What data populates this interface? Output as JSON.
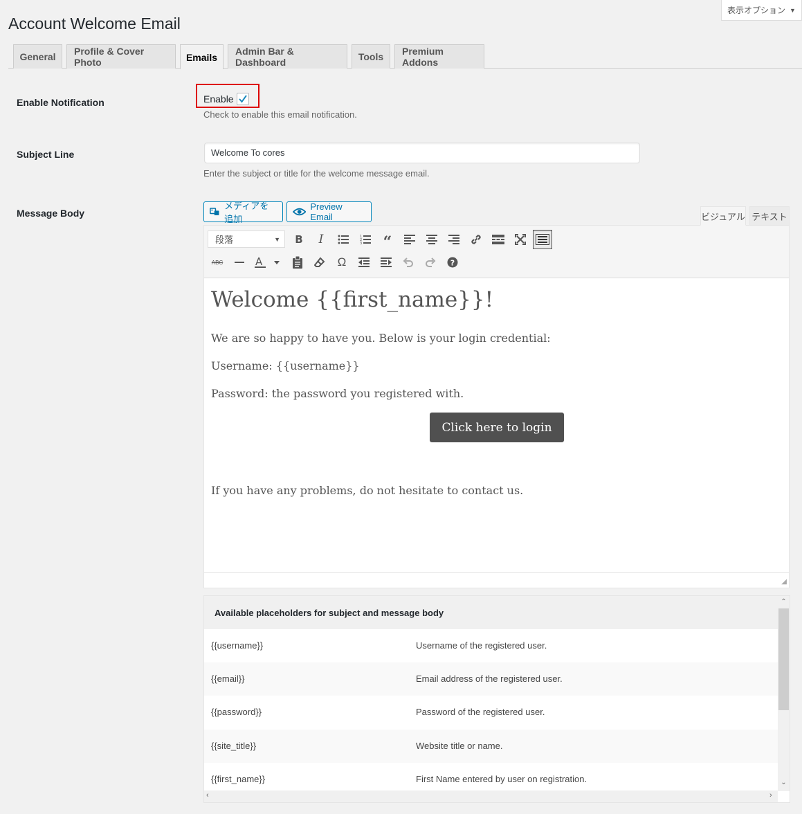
{
  "screen_options": "表示オプション",
  "page_title": "Account Welcome Email",
  "tabs": [
    "General",
    "Profile & Cover Photo",
    "Emails",
    "Admin Bar & Dashboard",
    "Tools",
    "Premium Addons"
  ],
  "active_tab": "Emails",
  "enable_notification": {
    "label": "Enable Notification",
    "checkbox_label": "Enable",
    "checked": true,
    "description": "Check to enable this email notification."
  },
  "subject": {
    "label": "Subject Line",
    "value": "Welcome To cores",
    "description": "Enter the subject or title for the welcome message email."
  },
  "message_body": {
    "label": "Message Body",
    "add_media": "メディアを追加",
    "preview_email": "Preview Email",
    "tab_visual": "ビジュアル",
    "tab_text": "テキスト",
    "format_select": "段落",
    "content": {
      "heading": "Welcome {{first_name}}!",
      "line1": "We are so happy to have you. Below is your login credential:",
      "line2": "Username: {{username}}",
      "line3": "Password: the password you registered with.",
      "button": "Click here to login",
      "line4": "If you have any problems, do not hesitate to contact us."
    }
  },
  "placeholders": {
    "title": "Available placeholders for subject and message body",
    "rows": [
      {
        "key": "{{username}}",
        "desc": "Username of the registered user."
      },
      {
        "key": "{{email}}",
        "desc": "Email address of the registered user."
      },
      {
        "key": "{{password}}",
        "desc": "Password of the registered user."
      },
      {
        "key": "{{site_title}}",
        "desc": "Website title or name."
      },
      {
        "key": "{{first_name}}",
        "desc": "First Name entered by user on registration."
      }
    ]
  },
  "colors": {
    "accent": "#0073aa",
    "highlight_box": "#dd0000",
    "login_button": "#505050"
  }
}
